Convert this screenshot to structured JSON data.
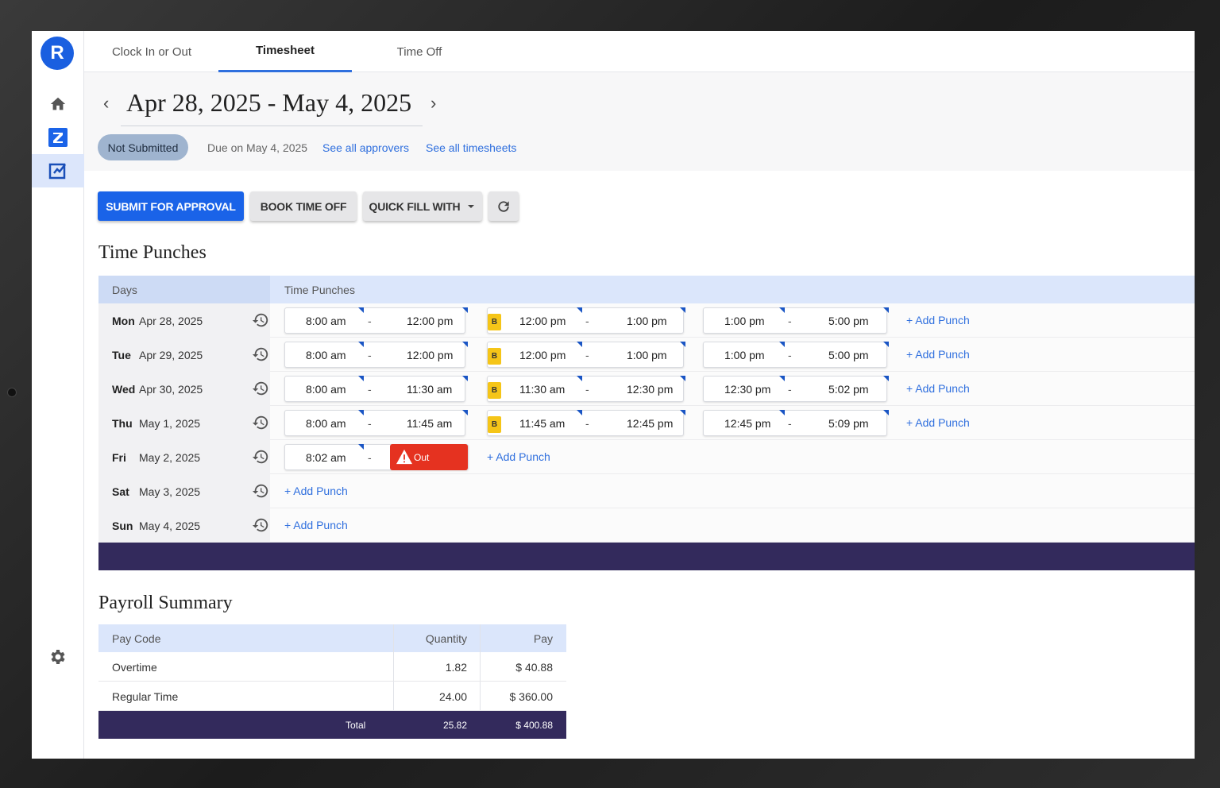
{
  "app": {
    "logo_letter": "R"
  },
  "tabs": [
    {
      "label": "Clock In or Out"
    },
    {
      "label": "Timesheet"
    },
    {
      "label": "Time Off"
    }
  ],
  "period": {
    "range": "Apr 28, 2025 - May 4, 2025",
    "prev_arrow": "‹",
    "next_arrow": "›",
    "status": "Not Submitted",
    "due": "Due on May 4, 2025",
    "approvers_link": "See all approvers",
    "timesheets_link": "See all timesheets"
  },
  "actions": {
    "submit": "SUBMIT FOR APPROVAL",
    "book": "BOOK TIME OFF",
    "quickfill": "QUICK FILL WITH"
  },
  "punches": {
    "title": "Time Punches",
    "col_days": "Days",
    "col_punches": "Time Punches",
    "add_label": "+ Add Punch",
    "break_badge": "B",
    "missing_out_label": "Out",
    "rows": [
      {
        "day": "Mon",
        "date": "Apr 28, 2025",
        "p1": [
          "8:00 am",
          "12:00 pm"
        ],
        "p2": [
          "12:00 pm",
          "1:00 pm"
        ],
        "p3": [
          "1:00 pm",
          "5:00 pm"
        ]
      },
      {
        "day": "Tue",
        "date": "Apr 29, 2025",
        "p1": [
          "8:00 am",
          "12:00 pm"
        ],
        "p2": [
          "12:00 pm",
          "1:00 pm"
        ],
        "p3": [
          "1:00 pm",
          "5:00 pm"
        ]
      },
      {
        "day": "Wed",
        "date": "Apr 30, 2025",
        "p1": [
          "8:00 am",
          "11:30 am"
        ],
        "p2": [
          "11:30 am",
          "12:30 pm"
        ],
        "p3": [
          "12:30 pm",
          "5:02 pm"
        ]
      },
      {
        "day": "Thu",
        "date": "May 1, 2025",
        "p1": [
          "8:00 am",
          "11:45 am"
        ],
        "p2": [
          "11:45 am",
          "12:45 pm"
        ],
        "p3": [
          "12:45 pm",
          "5:09 pm"
        ]
      },
      {
        "day": "Fri",
        "date": "May 2, 2025",
        "p1": [
          "8:02 am"
        ]
      },
      {
        "day": "Sat",
        "date": "May 3, 2025"
      },
      {
        "day": "Sun",
        "date": "May 4, 2025"
      }
    ]
  },
  "payroll": {
    "title": "Payroll Summary",
    "headers": {
      "code": "Pay Code",
      "qty": "Quantity",
      "pay": "Pay"
    },
    "rows": [
      {
        "code": "Overtime",
        "qty": "1.82",
        "pay": "$ 40.88"
      },
      {
        "code": "Regular Time",
        "qty": "24.00",
        "pay": "$ 360.00"
      }
    ],
    "total": {
      "label": "Total",
      "qty": "25.82",
      "pay": "$ 400.88"
    }
  },
  "colors": {
    "accent": "#1a63e8",
    "footer": "#332a5c",
    "break": "#f5c518",
    "error": "#e53220"
  }
}
